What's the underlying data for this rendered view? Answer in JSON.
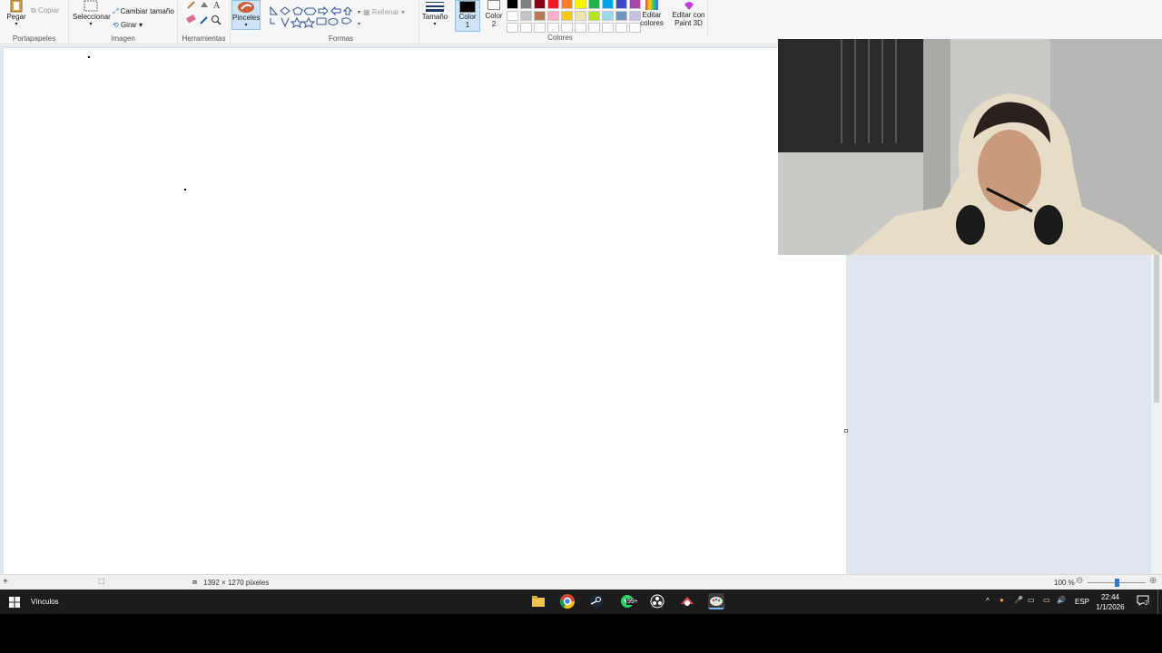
{
  "ribbon": {
    "portapapeles": {
      "group_label": "Portapapeles",
      "paste_label": "Pegar",
      "copy_label": "Copiar"
    },
    "imagen": {
      "group_label": "Imagen",
      "select_label": "Seleccionar",
      "resize_label": "Cambiar tamaño",
      "rotate_label": "Girar"
    },
    "herramientas": {
      "group_label": "Herramientas"
    },
    "pinceles": {
      "label": "Pinceles"
    },
    "formas": {
      "group_label": "Formas",
      "fill_label": "Rellenar"
    },
    "tamano": {
      "label": "Tamaño"
    },
    "color1": {
      "label_line1": "Color",
      "label_line2": "1",
      "value": "#000000"
    },
    "color2": {
      "label_line1": "Color",
      "label_line2": "2",
      "value": "#ffffff"
    },
    "colores": {
      "group_label": "Colores"
    },
    "palette": [
      "#000000",
      "#7f7f7f",
      "#880015",
      "#ed1c24",
      "#ff7f27",
      "#fff200",
      "#22b14c",
      "#00a2e8",
      "#3f48cc",
      "#a349a4",
      "#ffffff",
      "#c3c3c3",
      "#b97a57",
      "#ffaec9",
      "#ffc90e",
      "#efe4b0",
      "#b5e61d",
      "#99d9ea",
      "#7092be",
      "#c8bfe7",
      "#ffffff",
      "#ffffff",
      "#ffffff",
      "#ffffff",
      "#ffffff",
      "#ffffff",
      "#ffffff",
      "#ffffff",
      "#ffffff",
      "#ffffff"
    ],
    "edit_colors": {
      "label_line1": "Editar",
      "label_line2": "colores"
    },
    "paint3d": {
      "label_line1": "Editar con",
      "label_line2": "Paint 3D"
    }
  },
  "status": {
    "dimensions": "1392 × 1270 píxeles",
    "zoom": "100 %",
    "zoom_fraction": 0.5
  },
  "taskbar": {
    "vinculos": "Vínculos",
    "whatsapp_badge": "99+",
    "lang": "ESP",
    "time": "22:44",
    "date": "1/1/2026",
    "notif_count": "2"
  }
}
